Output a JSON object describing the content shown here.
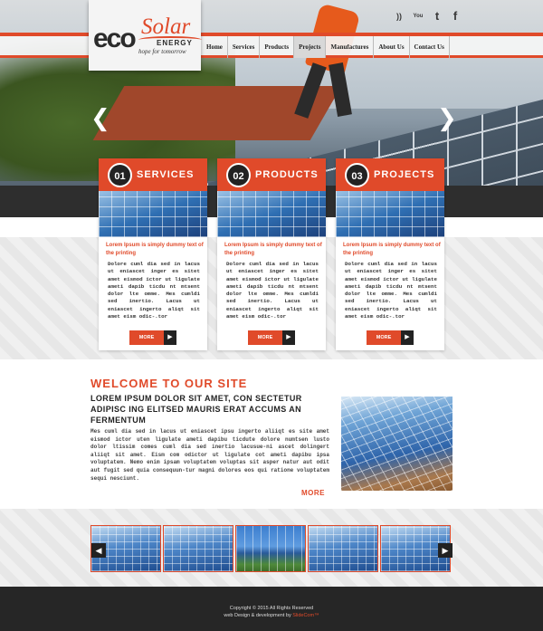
{
  "brand": {
    "logo_eco": "eco",
    "logo_solar": "Solar",
    "logo_energy": "ENERGY",
    "logo_tagline": "hope for tomorrow",
    "accent_color": "#e04a2a"
  },
  "social": [
    {
      "icon": "rss-icon",
      "glyph": "))"
    },
    {
      "icon": "youtube-icon",
      "glyph": "You"
    },
    {
      "icon": "twitter-icon",
      "glyph": "t"
    },
    {
      "icon": "facebook-icon",
      "glyph": "f"
    }
  ],
  "nav": {
    "items": [
      "Home",
      "Services",
      "Products",
      "Projects",
      "Manufactures",
      "About Us",
      "Contact Us"
    ],
    "active": "Projects"
  },
  "slider": {
    "prev_glyph": "❮",
    "next_glyph": "❯"
  },
  "cards": [
    {
      "number": "01",
      "title": "SERVICES",
      "subtitle": "Lorem Ipsum is simply dummy text of the printing",
      "body": "Dolore cuml dia sed in lacus ut eniascet inger es sitet amet eismod ictor ut ligulate ameti dapib ticdu nt mtsent dolor lte omme. Mes cumldi sed inertio. Lacus ut eniascet ingerto aliqt sit amet eism odic-.tor",
      "more": "MORE",
      "more_arrow": "▶"
    },
    {
      "number": "02",
      "title": "PRODUCTS",
      "subtitle": "Lorem Ipsum is simply dummy text of the printing",
      "body": "Dolore cuml dia sed in lacus ut eniascet inger es sitet amet eismod ictor ut ligulate ameti dapib ticdu nt mtsent dolor lte omme. Mes cumldi sed inertio. Lacus ut eniascet ingerto aliqt sit amet eism odic-.tor",
      "more": "MORE",
      "more_arrow": "▶"
    },
    {
      "number": "03",
      "title": "PROJECTS",
      "subtitle": "Lorem Ipsum is simply dummy text of the printing",
      "body": "Dolore cuml dia sed in lacus ut eniascet inger es sitet amet eismod ictor ut ligulate ameti dapib ticdu nt mtsent dolor lte omme. Mes cumldi sed inertio. Lacus ut eniascet ingerto aliqt sit amet eism odic-.tor",
      "more": "MORE",
      "more_arrow": "▶"
    }
  ],
  "welcome": {
    "title": "WELCOME TO OUR SITE",
    "subtitle": "LOREM IPSUM DOLOR SIT AMET, CON SECTETUR ADIPISC ING ELITSED MAURIS ERAT ACCUMS AN FERMENTUM",
    "body": "Mes cuml dia sed in lacus ut eniascet ipsu ingerto aliiqt es site amet eismod ictor uten ligulate ameti dapibu ticdute dolore numtsen lusto dolor ltissim comes cuml dia sed inertio lacusue-ni ascet dolingert aliiqt sit amet. Eism com odictor ut ligulate cot ameti dapibu ipsa voluptatem. Nemo enim ipsam voluptatem voluptas sit asper natur aut odit aut fugit sed quia consequun-tur magni dolores eos qui ratione voluptatem sequi nesciunt.",
    "more": "MORE"
  },
  "gallery": {
    "prev_glyph": "◀",
    "next_glyph": "▶"
  },
  "footer": {
    "copyright": "Copyright © 2015 All Rights Reserved",
    "credit_prefix": "web Design & development by ",
    "credit_brand": "SlideCom™"
  }
}
